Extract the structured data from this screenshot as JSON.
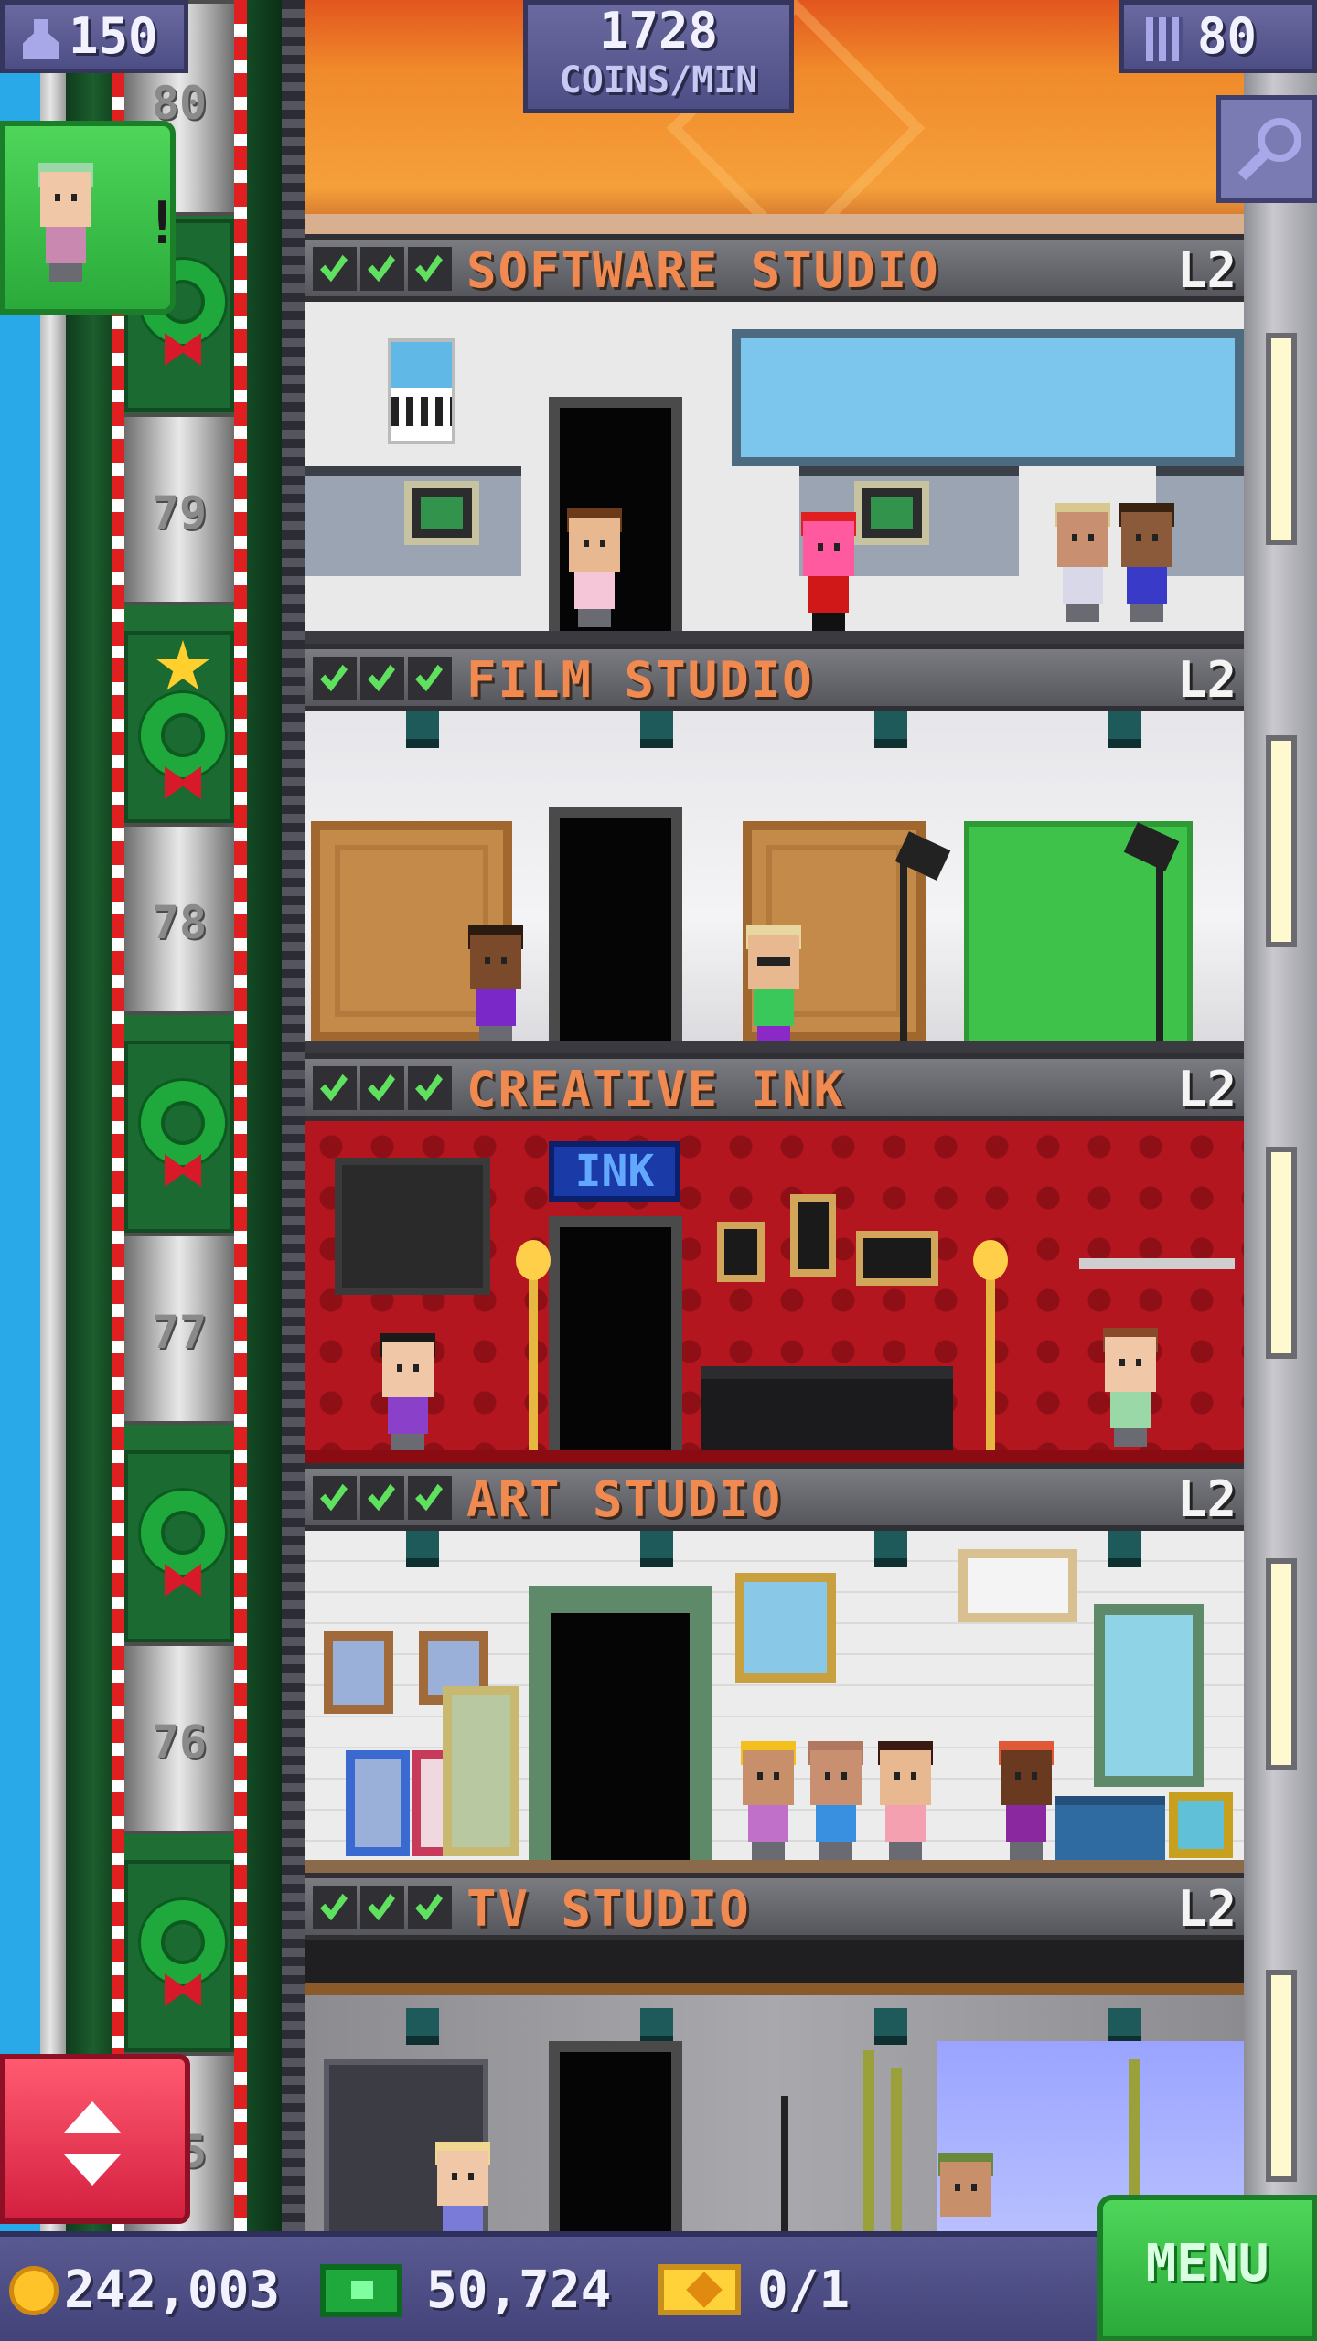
{
  "hud": {
    "population": "150",
    "coins_per_min": "1728",
    "coins_per_min_unit": "COINS/MIN",
    "floors_count": "80"
  },
  "elevator": {
    "floor_labels": [
      "80",
      "79",
      "78",
      "77",
      "76",
      "75"
    ]
  },
  "floors": [
    {
      "name": "SOFTWARE STUDIO",
      "level": "L2",
      "checks": 3
    },
    {
      "name": "FILM STUDIO",
      "level": "L2",
      "checks": 3
    },
    {
      "name": "CREATIVE INK",
      "level": "L2",
      "checks": 3,
      "sign": "INK"
    },
    {
      "name": "ART STUDIO",
      "level": "L2",
      "checks": 3
    },
    {
      "name": "TV STUDIO",
      "level": "L2",
      "checks": 3
    }
  ],
  "currency": {
    "coins": "242,003",
    "bux": "50,724",
    "tickets": "0/1"
  },
  "menu_label": "MENU",
  "icons": {
    "population": "person-up-icon",
    "floors": "building-icon",
    "search": "magnifier-icon",
    "coins": "coin-icon",
    "bux": "banknote-icon",
    "tickets": "golden-ticket-icon",
    "elevator": "up-down-arrows-icon"
  },
  "colors": {
    "floor_title": "#f08a50",
    "check": "#5fe05f",
    "menu_button": "#2aaa3a",
    "elevator_button": "#d42040",
    "hud": "#4e4e86"
  }
}
